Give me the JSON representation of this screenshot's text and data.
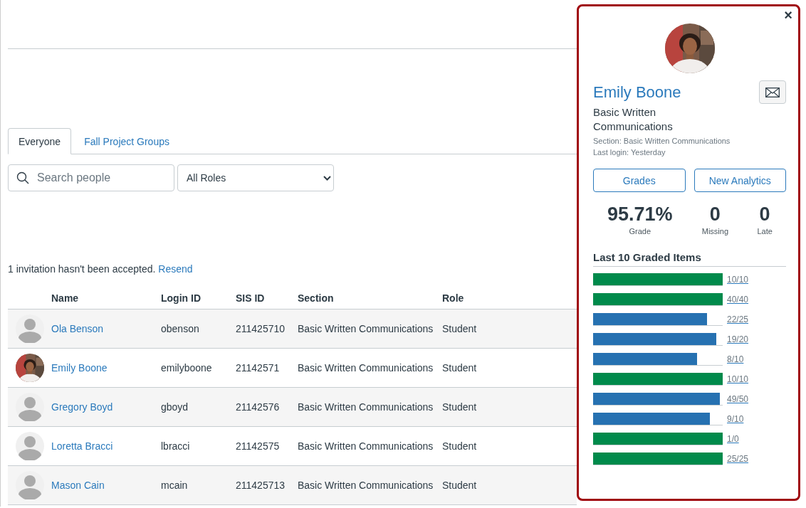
{
  "tabs": [
    {
      "label": "Everyone",
      "selected": true
    },
    {
      "label": "Fall Project Groups",
      "selected": false
    }
  ],
  "search": {
    "placeholder": "Search people"
  },
  "role_filter": {
    "value": "All Roles"
  },
  "invitation": {
    "message": "1 invitation hasn't been accepted.",
    "link": "Resend"
  },
  "table": {
    "columns": [
      "Name",
      "Login ID",
      "SIS ID",
      "Section",
      "Role"
    ],
    "rows": [
      {
        "kind": "default",
        "name": "Ola Benson",
        "login_id": "obenson",
        "sis_id": "211425710",
        "section": "Basic Written Communications",
        "role": "Student"
      },
      {
        "name": "Emily Boone",
        "login_id": "emilyboone",
        "sis_id": "21142571",
        "section": "Basic Written Communications",
        "role": "Student"
      },
      {
        "kind": "default",
        "name": "Gregory Boyd",
        "login_id": "gboyd",
        "sis_id": "21142576",
        "section": "Basic Written Communications",
        "role": "Student"
      },
      {
        "kind": "default",
        "name": "Loretta Bracci",
        "login_id": "lbracci",
        "sis_id": "21142575",
        "section": "Basic Written Communications",
        "role": "Student"
      },
      {
        "kind": "default",
        "name": "Mason Cain",
        "login_id": "mcain",
        "sis_id": "211425713",
        "section": "Basic Written Communications",
        "role": "Student"
      }
    ]
  },
  "profile_panel": {
    "close": "×",
    "name": "Emily Boone",
    "course": "Basic Written Communications",
    "section": "Section: Basic Written Communications",
    "last_login": "Last login: Yesterday",
    "buttons": [
      "Grades",
      "New Analytics"
    ],
    "stats": [
      {
        "value": "95.71%",
        "label": "Grade"
      },
      {
        "value": "0",
        "label": "Missing"
      },
      {
        "value": "0",
        "label": "Late"
      }
    ],
    "graded_title": "Last 10 Graded Items",
    "graded_items": [
      {
        "score": "10/10",
        "level": 1,
        "color": "#008a4b"
      },
      {
        "score": "40/40",
        "level": 1,
        "color": "#008a4b"
      },
      {
        "score": "22/25",
        "level": 0.88,
        "color": "#2671b1"
      },
      {
        "score": "19/20",
        "level": 0.95,
        "color": "#2671b1"
      },
      {
        "score": "8/10",
        "level": 0.8,
        "color": "#2671b1"
      },
      {
        "score": "10/10",
        "level": 1,
        "color": "#008a4b"
      },
      {
        "score": "49/50",
        "level": 0.98,
        "color": "#2671b1"
      },
      {
        "score": "9/10",
        "level": 0.9,
        "color": "#2671b1"
      },
      {
        "score": "1/0",
        "level": 1,
        "color": "#008a4b"
      },
      {
        "score": "25/25",
        "level": 1,
        "color": "#008a4b"
      }
    ]
  }
}
